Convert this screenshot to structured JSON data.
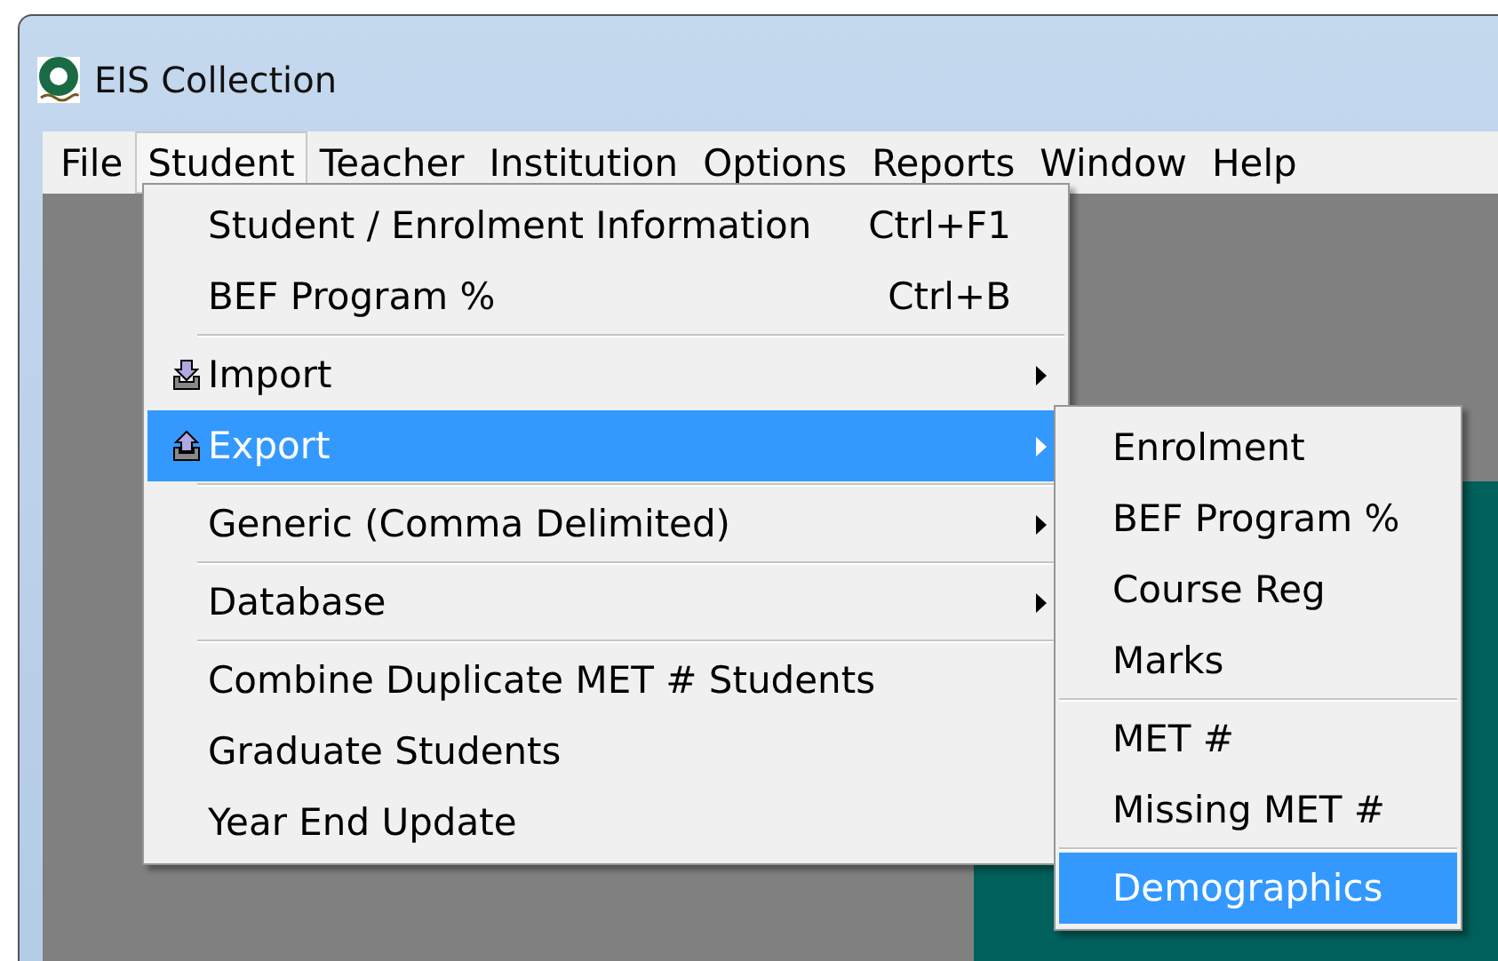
{
  "window": {
    "title": "EIS Collection"
  },
  "menu_bar": [
    {
      "label": "File",
      "selected": false
    },
    {
      "label": "Student",
      "selected": true
    },
    {
      "label": "Teacher",
      "selected": false
    },
    {
      "label": "Institution",
      "selected": false
    },
    {
      "label": "Options",
      "selected": false
    },
    {
      "label": "Reports",
      "selected": false
    },
    {
      "label": "Window",
      "selected": false
    },
    {
      "label": "Help",
      "selected": false
    }
  ],
  "student_menu": [
    [
      {
        "label": "Student / Enrolment Information",
        "shortcut": "Ctrl+F1",
        "submenu": false,
        "selected": false
      },
      {
        "label": "BEF Program %",
        "shortcut": "Ctrl+B",
        "submenu": false,
        "selected": false
      }
    ],
    [
      {
        "label": "Import",
        "kind": "import",
        "submenu": true,
        "selected": false
      },
      {
        "label": "Export",
        "kind": "export",
        "submenu": true,
        "selected": true
      }
    ],
    [
      {
        "label": "Generic (Comma Delimited)",
        "submenu": true,
        "selected": false
      }
    ],
    [
      {
        "label": "Database",
        "submenu": true,
        "selected": false
      }
    ],
    [
      {
        "label": "Combine Duplicate MET # Students",
        "submenu": false,
        "selected": false
      },
      {
        "label": "Graduate Students",
        "submenu": false,
        "selected": false
      },
      {
        "label": "Year End Update",
        "submenu": false,
        "selected": false
      }
    ]
  ],
  "export_submenu": [
    [
      {
        "label": "Enrolment",
        "selected": false
      },
      {
        "label": "BEF Program %",
        "selected": false
      },
      {
        "label": "Course Reg",
        "selected": false
      },
      {
        "label": "Marks",
        "selected": false
      }
    ],
    [
      {
        "label": "MET #",
        "selected": false
      },
      {
        "label": "Missing MET #",
        "selected": false
      }
    ],
    [
      {
        "label": "Demographics",
        "selected": true
      }
    ]
  ]
}
